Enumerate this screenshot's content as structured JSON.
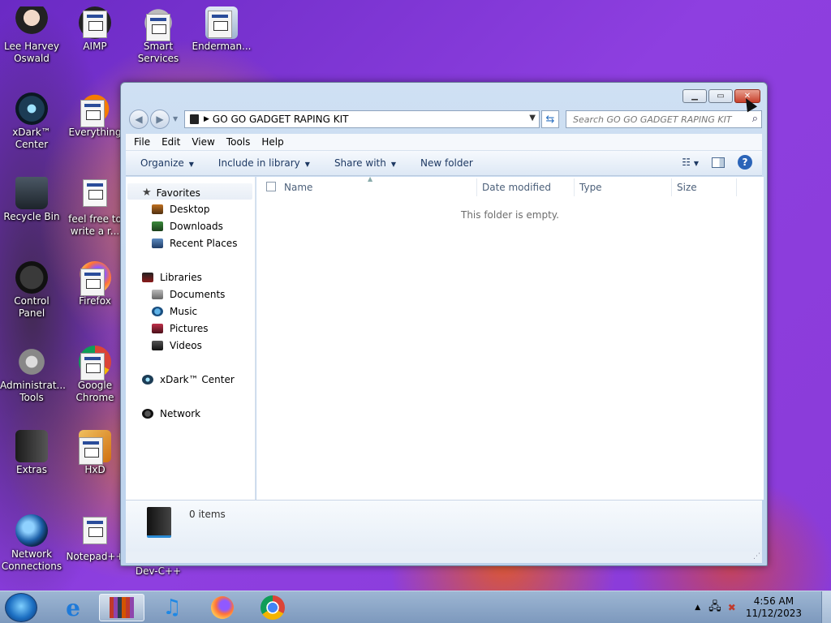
{
  "desktop": {
    "icons": [
      {
        "label": "Lee Harvey Oswald"
      },
      {
        "label": "AIMP"
      },
      {
        "label": "Smart Services"
      },
      {
        "label": "Enderman..."
      },
      {
        "label": "xDark™ Center"
      },
      {
        "label": "Everything"
      },
      {
        "label": "Recycle Bin"
      },
      {
        "label": "feel free to write a r..."
      },
      {
        "label": "Control Panel"
      },
      {
        "label": "Firefox"
      },
      {
        "label": "Administrat... Tools"
      },
      {
        "label": "Google Chrome"
      },
      {
        "label": "Extras"
      },
      {
        "label": "HxD"
      },
      {
        "label": "Network Connections"
      },
      {
        "label": "Notepad++"
      },
      {
        "label": "Dev-C++"
      }
    ]
  },
  "window": {
    "address": "GO GO GADGET RAPING KIT",
    "search_placeholder": "Search GO GO GADGET RAPING KIT",
    "menu": [
      "File",
      "Edit",
      "View",
      "Tools",
      "Help"
    ],
    "toolbar": {
      "organize": "Organize",
      "include_in_library": "Include in library",
      "share_with": "Share with",
      "new_folder": "New folder"
    },
    "nav": {
      "favorites": "Favorites",
      "desktop": "Desktop",
      "downloads": "Downloads",
      "recent_places": "Recent Places",
      "libraries": "Libraries",
      "documents": "Documents",
      "music": "Music",
      "pictures": "Pictures",
      "videos": "Videos",
      "xdark_center": "xDark™ Center",
      "network": "Network"
    },
    "columns": {
      "name": "Name",
      "date_modified": "Date modified",
      "type": "Type",
      "size": "Size"
    },
    "empty_message": "This folder is empty.",
    "details": {
      "item_count": "0 items"
    }
  },
  "taskbar": {
    "clock_time": "4:56 AM",
    "clock_date": "11/12/2023"
  }
}
